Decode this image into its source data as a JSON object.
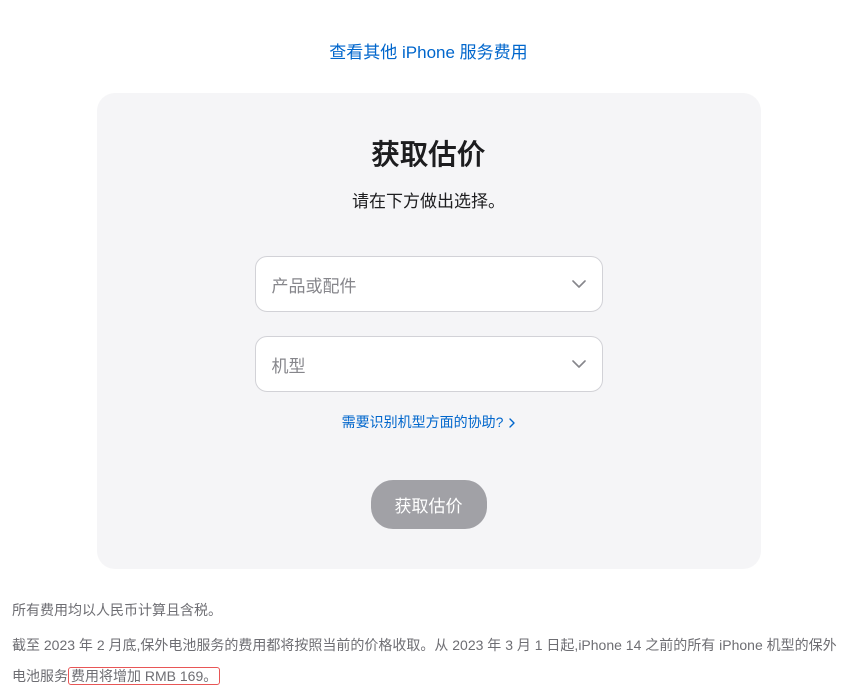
{
  "topLink": "查看其他 iPhone 服务费用",
  "card": {
    "title": "获取估价",
    "subtitle": "请在下方做出选择。",
    "select1": "产品或配件",
    "select2": "机型",
    "helpLink": "需要识别机型方面的协助?",
    "submit": "获取估价"
  },
  "footer": {
    "line1": "所有费用均以人民币计算且含税。",
    "line2a": "截至 2023 年 2 月底,保外电池服务的费用都将按照当前的价格收取。从 2023 年 3 月 1 日起,iPhone 14 之前的所有 iPhone 机型的保外电池服务",
    "line2b": "费用将增加 RMB 169。"
  }
}
